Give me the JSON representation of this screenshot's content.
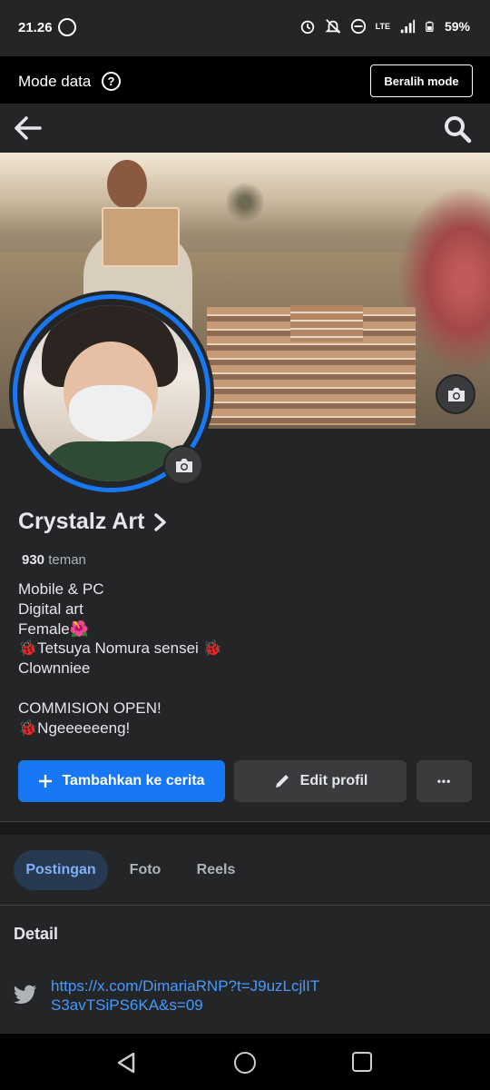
{
  "status_bar": {
    "time": "21.26",
    "network": "LTE",
    "battery": "59%",
    "icons": [
      "whatsapp-icon",
      "alarm-icon",
      "notifications-off-icon",
      "do-not-disturb-icon",
      "signal-icon",
      "battery-icon"
    ]
  },
  "mode_bar": {
    "label": "Mode data",
    "help_glyph": "?",
    "switch_label": "Beralih mode"
  },
  "nav": {
    "back_icon": "arrow-left-icon",
    "search_icon": "search-icon"
  },
  "profile": {
    "name": "Crystalz Art",
    "friends_count": "930",
    "friends_label": "teman",
    "bio_lines": [
      "Mobile & PC",
      "Digital art",
      "Female🌺",
      "🐞Tetsuya Nomura sensei 🐞",
      "Clownniee",
      "",
      "COMMISION OPEN!",
      "🐞Ngeeeeeeng!"
    ]
  },
  "actions": {
    "story_label": "Tambahkan ke cerita",
    "edit_label": "Edit profil",
    "more_glyph": "•••"
  },
  "tabs": [
    {
      "label": "Postingan",
      "active": true
    },
    {
      "label": "Foto",
      "active": false
    },
    {
      "label": "Reels",
      "active": false
    }
  ],
  "details": {
    "title": "Detail",
    "twitter_link": "https://x.com/DimariaRNP?t=J9uzLcjlITS3avTSiPS6KA&s=09"
  },
  "colors": {
    "accent": "#1877f2",
    "background": "#242526",
    "link": "#4599ff"
  }
}
